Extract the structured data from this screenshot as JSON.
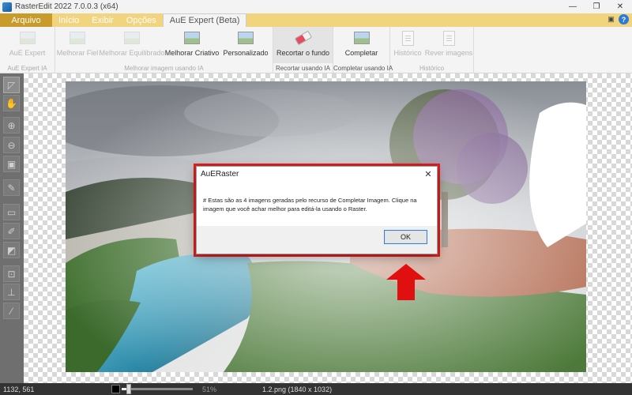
{
  "window": {
    "title": "RasterEdit 2022 7.0.0.3 (x64)",
    "controls": {
      "minimize": "—",
      "restore": "❐",
      "close": "✕"
    }
  },
  "tabs": [
    {
      "label": "Arquivo",
      "kind": "file"
    },
    {
      "label": "Início",
      "kind": "normal"
    },
    {
      "label": "Exibir",
      "kind": "normal"
    },
    {
      "label": "Opções",
      "kind": "normal"
    },
    {
      "label": "AuE Expert (Beta)",
      "kind": "active"
    }
  ],
  "ribbon": {
    "groups": [
      {
        "label": "AuE Expert IA",
        "enabled": false,
        "buttons": [
          {
            "label": "AuE Expert",
            "icon": "image-icon",
            "enabled": false
          }
        ]
      },
      {
        "label": "Melhorar imagem usando IA",
        "enabled": false,
        "buttons": [
          {
            "label": "Melhorar Fiel",
            "icon": "image-icon",
            "enabled": false
          },
          {
            "label": "Melhorar Equilibrado",
            "icon": "image-icon",
            "enabled": false
          },
          {
            "label": "Melhorar Criativo",
            "icon": "image-icon",
            "enabled": true
          },
          {
            "label": "Personalizado",
            "icon": "image-icon",
            "enabled": true
          }
        ]
      },
      {
        "label": "Recortar usando IA",
        "enabled": true,
        "buttons": [
          {
            "label": "Recortar o fundo",
            "icon": "eraser-icon",
            "enabled": true,
            "selected": true
          }
        ]
      },
      {
        "label": "Completar usando IA",
        "enabled": true,
        "buttons": [
          {
            "label": "Completar",
            "icon": "magic-image-icon",
            "enabled": true
          }
        ]
      },
      {
        "label": "Histórico",
        "enabled": false,
        "buttons": [
          {
            "label": "Histórico",
            "icon": "document-icon",
            "enabled": false
          },
          {
            "label": "Rever imagens",
            "icon": "document-icon",
            "enabled": false
          }
        ]
      }
    ]
  },
  "dialog": {
    "title": "AuERaster",
    "close": "✕",
    "message": "# Estas são as 4 imagens geradas pelo recurso de Completar Imagem. Clique na imagem que você achar melhor para editá-la usando o Raster.",
    "ok_label": "OK"
  },
  "status": {
    "coords": "1132, 561",
    "zoom_percent": "51%",
    "zoom_level": 0.1,
    "file_info": "1.2.png (1840 x 1032)"
  },
  "colors": {
    "tab_bar": "#f2d37e",
    "file_tab": "#c89b2b",
    "highlight_border": "#e02020",
    "arrow": "#e01010"
  }
}
